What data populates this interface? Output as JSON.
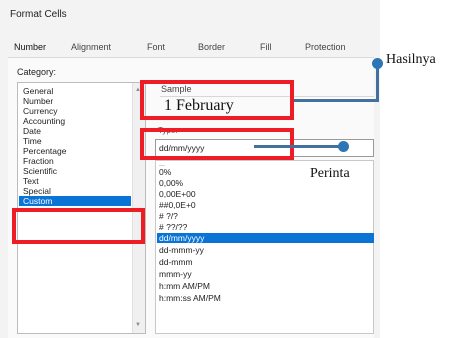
{
  "dialog": {
    "title": "Format Cells"
  },
  "tabs": [
    "Number",
    "Alignment",
    "Font",
    "Border",
    "Fill",
    "Protection"
  ],
  "category": {
    "label": "Category:",
    "items": [
      "General",
      "Number",
      "Currency",
      "Accounting",
      "Date",
      "Time",
      "Percentage",
      "Fraction",
      "Scientific",
      "Text",
      "Special",
      "Custom"
    ],
    "selected": "Custom"
  },
  "sample": {
    "label": "Sample",
    "value": "1 February"
  },
  "type": {
    "label": "Type:",
    "input_value": "dd/mm/yyyy",
    "list_top_partial": "...",
    "items": [
      "0%",
      "0,00%",
      "0,00E+00",
      "##0,0E+0",
      "# ?/?",
      "# ??/??",
      "dd/mm/yyyy",
      "dd-mmm-yy",
      "dd-mmm",
      "mmm-yy",
      "h:mm AM/PM",
      "h:mm:ss AM/PM"
    ],
    "selected": "dd/mm/yyyy"
  },
  "annotations": {
    "result_label": "Hasilnya",
    "command_label": "Perinta",
    "highlight_color": "#ee1c24",
    "connector_color": "#41719c"
  }
}
